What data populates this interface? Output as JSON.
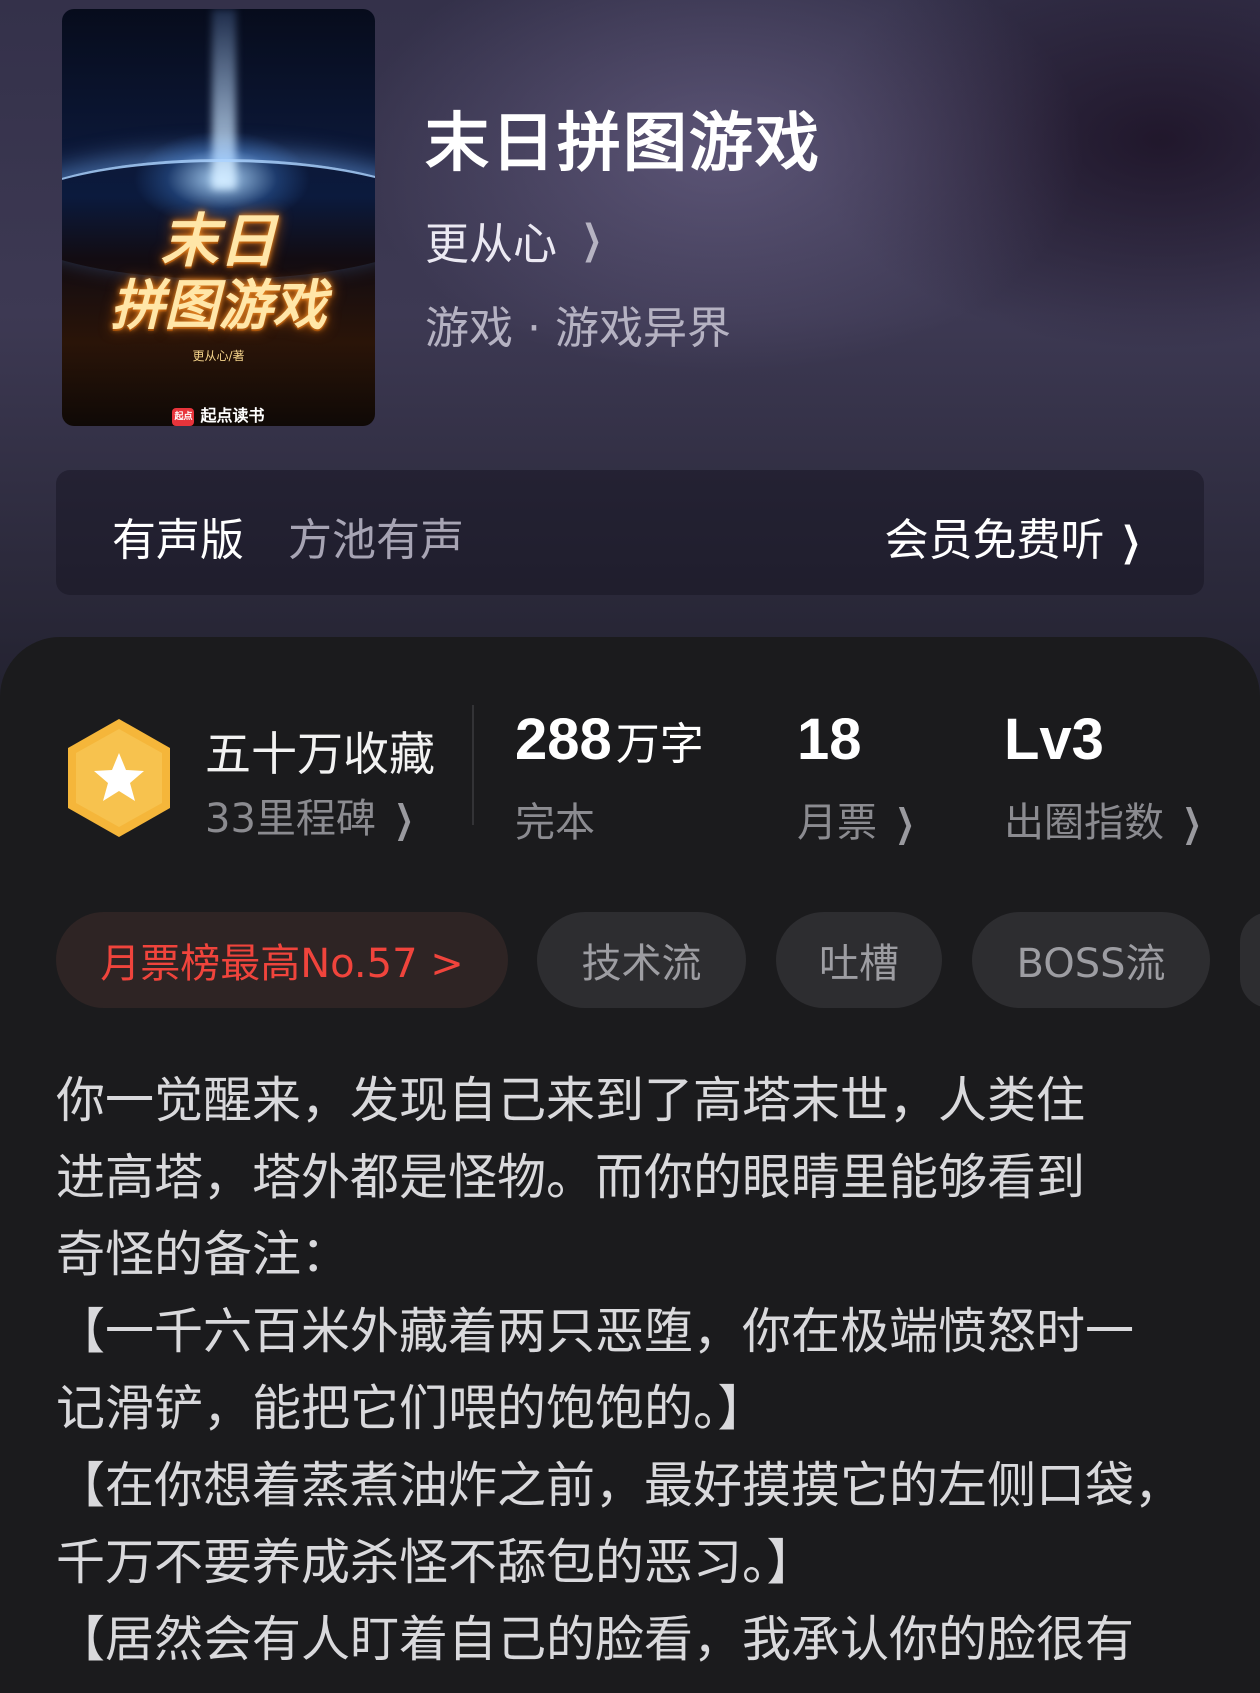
{
  "book": {
    "cover": {
      "title_line1": "末日",
      "title_line2": "拼图游戏",
      "subtitle": "更从心/著",
      "publisher": "起点读书",
      "publisher_logo": "起点"
    },
    "title": "末日拼图游戏",
    "author": "更从心",
    "genre": "游戏 · 游戏异界"
  },
  "audio": {
    "label": "有声版",
    "narrator": "方池有声",
    "cta": "会员免费听"
  },
  "stats": {
    "favorites_title": "五十万收藏",
    "favorites_sub": "33里程碑",
    "words_value": "288",
    "words_unit": "万字",
    "words_status": "完本",
    "monthly_votes_value": "18",
    "monthly_votes_label": "月票",
    "influence_value": "Lv3",
    "influence_label": "出圈指数"
  },
  "tags": [
    {
      "label": "月票榜最高No.57 >"
    },
    {
      "label": "技术流"
    },
    {
      "label": "吐槽"
    },
    {
      "label": "BOSS流"
    }
  ],
  "description": [
    "你一觉醒来，发现自己来到了高塔末世，人类住",
    "进高塔，塔外都是怪物。而你的眼睛里能够看到",
    "奇怪的备注：",
    "【一千六百米外藏着两只恶堕，你在极端愤怒时一",
    "记滑铲，能把它们喂的饱饱的。】",
    "【在你想着蒸煮油炸之前，最好摸摸它的左侧口袋，",
    "千万不要养成杀怪不舔包的恶习。】",
    "【居然会有人盯着自己的脸看，我承认你的脸很有"
  ],
  "colors": {
    "badge": "#f5b63a",
    "rank_tag_text": "#f0443c",
    "panel_bg": "#1b1b1d"
  },
  "icons": {
    "chevron": "chevron-right-icon",
    "badge": "star-hexagon-icon"
  }
}
